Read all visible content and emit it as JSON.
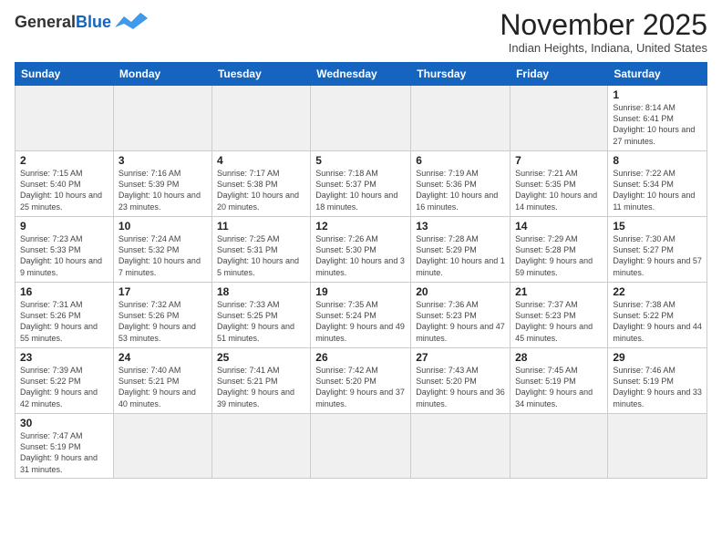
{
  "logo": {
    "line1": "General",
    "line2": "Blue"
  },
  "header": {
    "month": "November 2025",
    "location": "Indian Heights, Indiana, United States"
  },
  "weekdays": [
    "Sunday",
    "Monday",
    "Tuesday",
    "Wednesday",
    "Thursday",
    "Friday",
    "Saturday"
  ],
  "weeks": [
    [
      {
        "day": "",
        "info": ""
      },
      {
        "day": "",
        "info": ""
      },
      {
        "day": "",
        "info": ""
      },
      {
        "day": "",
        "info": ""
      },
      {
        "day": "",
        "info": ""
      },
      {
        "day": "",
        "info": ""
      },
      {
        "day": "1",
        "info": "Sunrise: 8:14 AM\nSunset: 6:41 PM\nDaylight: 10 hours\nand 27 minutes."
      }
    ],
    [
      {
        "day": "2",
        "info": "Sunrise: 7:15 AM\nSunset: 5:40 PM\nDaylight: 10 hours\nand 25 minutes."
      },
      {
        "day": "3",
        "info": "Sunrise: 7:16 AM\nSunset: 5:39 PM\nDaylight: 10 hours\nand 23 minutes."
      },
      {
        "day": "4",
        "info": "Sunrise: 7:17 AM\nSunset: 5:38 PM\nDaylight: 10 hours\nand 20 minutes."
      },
      {
        "day": "5",
        "info": "Sunrise: 7:18 AM\nSunset: 5:37 PM\nDaylight: 10 hours\nand 18 minutes."
      },
      {
        "day": "6",
        "info": "Sunrise: 7:19 AM\nSunset: 5:36 PM\nDaylight: 10 hours\nand 16 minutes."
      },
      {
        "day": "7",
        "info": "Sunrise: 7:21 AM\nSunset: 5:35 PM\nDaylight: 10 hours\nand 14 minutes."
      },
      {
        "day": "8",
        "info": "Sunrise: 7:22 AM\nSunset: 5:34 PM\nDaylight: 10 hours\nand 11 minutes."
      }
    ],
    [
      {
        "day": "9",
        "info": "Sunrise: 7:23 AM\nSunset: 5:33 PM\nDaylight: 10 hours\nand 9 minutes."
      },
      {
        "day": "10",
        "info": "Sunrise: 7:24 AM\nSunset: 5:32 PM\nDaylight: 10 hours\nand 7 minutes."
      },
      {
        "day": "11",
        "info": "Sunrise: 7:25 AM\nSunset: 5:31 PM\nDaylight: 10 hours\nand 5 minutes."
      },
      {
        "day": "12",
        "info": "Sunrise: 7:26 AM\nSunset: 5:30 PM\nDaylight: 10 hours\nand 3 minutes."
      },
      {
        "day": "13",
        "info": "Sunrise: 7:28 AM\nSunset: 5:29 PM\nDaylight: 10 hours\nand 1 minute."
      },
      {
        "day": "14",
        "info": "Sunrise: 7:29 AM\nSunset: 5:28 PM\nDaylight: 9 hours\nand 59 minutes."
      },
      {
        "day": "15",
        "info": "Sunrise: 7:30 AM\nSunset: 5:27 PM\nDaylight: 9 hours\nand 57 minutes."
      }
    ],
    [
      {
        "day": "16",
        "info": "Sunrise: 7:31 AM\nSunset: 5:26 PM\nDaylight: 9 hours\nand 55 minutes."
      },
      {
        "day": "17",
        "info": "Sunrise: 7:32 AM\nSunset: 5:26 PM\nDaylight: 9 hours\nand 53 minutes."
      },
      {
        "day": "18",
        "info": "Sunrise: 7:33 AM\nSunset: 5:25 PM\nDaylight: 9 hours\nand 51 minutes."
      },
      {
        "day": "19",
        "info": "Sunrise: 7:35 AM\nSunset: 5:24 PM\nDaylight: 9 hours\nand 49 minutes."
      },
      {
        "day": "20",
        "info": "Sunrise: 7:36 AM\nSunset: 5:23 PM\nDaylight: 9 hours\nand 47 minutes."
      },
      {
        "day": "21",
        "info": "Sunrise: 7:37 AM\nSunset: 5:23 PM\nDaylight: 9 hours\nand 45 minutes."
      },
      {
        "day": "22",
        "info": "Sunrise: 7:38 AM\nSunset: 5:22 PM\nDaylight: 9 hours\nand 44 minutes."
      }
    ],
    [
      {
        "day": "23",
        "info": "Sunrise: 7:39 AM\nSunset: 5:22 PM\nDaylight: 9 hours\nand 42 minutes."
      },
      {
        "day": "24",
        "info": "Sunrise: 7:40 AM\nSunset: 5:21 PM\nDaylight: 9 hours\nand 40 minutes."
      },
      {
        "day": "25",
        "info": "Sunrise: 7:41 AM\nSunset: 5:21 PM\nDaylight: 9 hours\nand 39 minutes."
      },
      {
        "day": "26",
        "info": "Sunrise: 7:42 AM\nSunset: 5:20 PM\nDaylight: 9 hours\nand 37 minutes."
      },
      {
        "day": "27",
        "info": "Sunrise: 7:43 AM\nSunset: 5:20 PM\nDaylight: 9 hours\nand 36 minutes."
      },
      {
        "day": "28",
        "info": "Sunrise: 7:45 AM\nSunset: 5:19 PM\nDaylight: 9 hours\nand 34 minutes."
      },
      {
        "day": "29",
        "info": "Sunrise: 7:46 AM\nSunset: 5:19 PM\nDaylight: 9 hours\nand 33 minutes."
      }
    ],
    [
      {
        "day": "30",
        "info": "Sunrise: 7:47 AM\nSunset: 5:19 PM\nDaylight: 9 hours\nand 31 minutes."
      },
      {
        "day": "",
        "info": ""
      },
      {
        "day": "",
        "info": ""
      },
      {
        "day": "",
        "info": ""
      },
      {
        "day": "",
        "info": ""
      },
      {
        "day": "",
        "info": ""
      },
      {
        "day": "",
        "info": ""
      }
    ]
  ]
}
